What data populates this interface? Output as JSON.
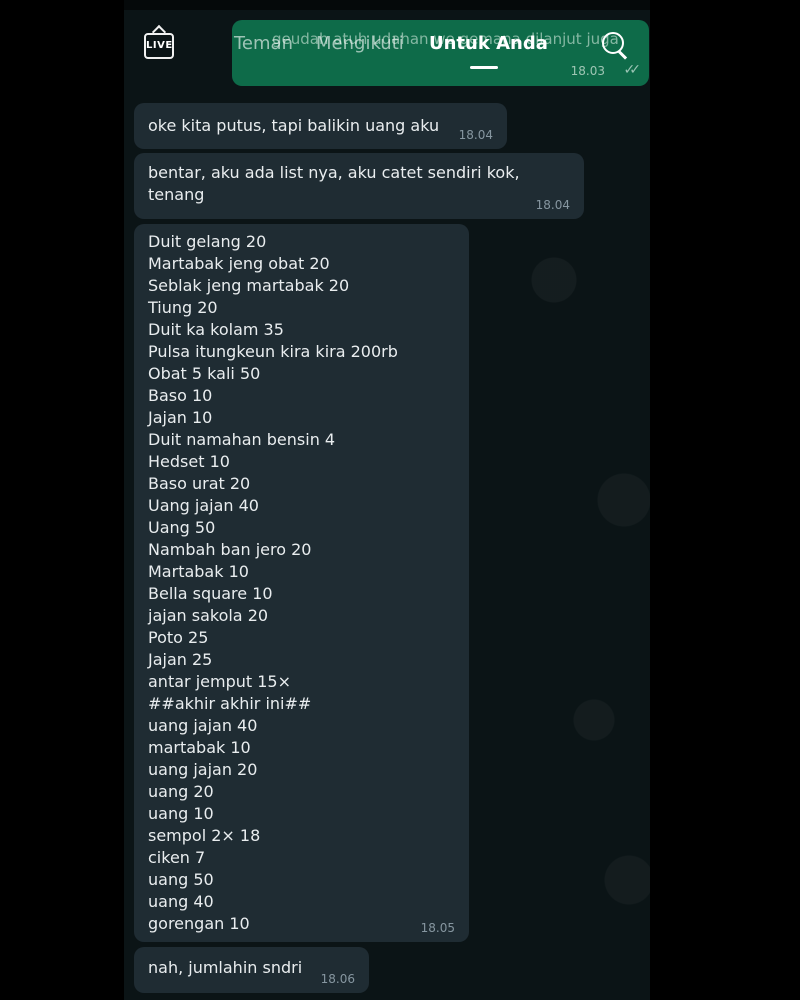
{
  "header": {
    "live_label": "LIVE",
    "tabs": [
      {
        "label": "Teman"
      },
      {
        "label": "Mengikuti"
      },
      {
        "label": "Untuk Anda"
      }
    ]
  },
  "outgoing_message": {
    "text": "geudah atuh udahan we gemana dilanjut juga",
    "time": "18.03",
    "ticks": "✓✓"
  },
  "messages": [
    {
      "text": "oke kita putus, tapi balikin uang aku",
      "time": "18.04"
    },
    {
      "text": "bentar, aku ada list nya, aku catet sendiri kok, tenang",
      "time": "18.04"
    },
    {
      "time": "18.05",
      "lines": [
        "Duit gelang 20",
        "Martabak jeng obat 20",
        "Seblak jeng martabak 20",
        "Tiung 20",
        "Duit ka kolam 35",
        "Pulsa itungkeun kira kira 200rb",
        "Obat 5 kali 50",
        "Baso 10",
        "Jajan 10",
        "Duit namahan bensin 4",
        "Hedset 10",
        "Baso urat 20",
        "Uang jajan 40",
        "Uang 50",
        "Nambah ban jero 20",
        "Martabak 10",
        "Bella square 10",
        "jajan sakola 20",
        "Poto 25",
        "Jajan 25",
        "antar jemput 15×",
        "##akhir akhir ini##",
        "uang jajan 40",
        "martabak 10",
        "uang jajan 20",
        "uang 20",
        "uang 10",
        "sempol 2× 18",
        "ciken 7",
        "uang 50",
        "uang 40",
        "gorengan 10"
      ]
    },
    {
      "text": "nah, jumlahin sndri",
      "time": "18.06"
    }
  ],
  "colors": {
    "background": "#0b1416",
    "incoming_bubble": "#1f2c33",
    "outgoing_bubble": "#0e6b49",
    "text": "#e9edef",
    "timestamp": "#8696a0"
  }
}
